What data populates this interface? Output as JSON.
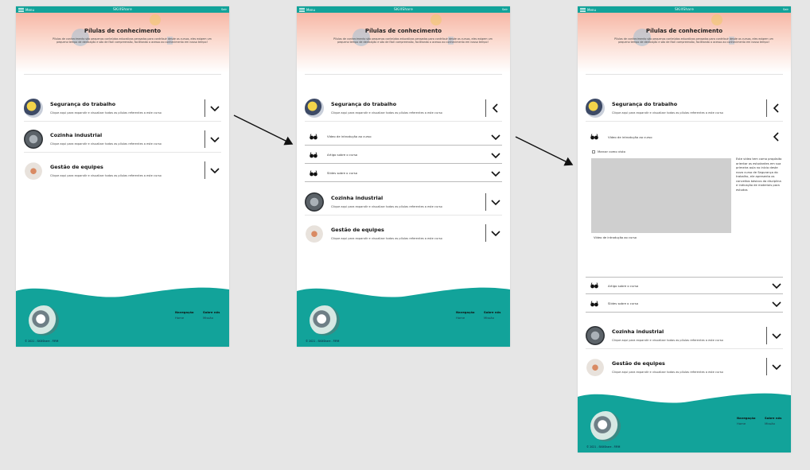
{
  "app": {
    "menu_label": "Menu",
    "brand": "SKillShare",
    "top_right": "Sair"
  },
  "hero": {
    "title": "Pílulas de conhecimento",
    "text": "Pílulas de conhecimento são pequenos conteúdos educativos pensados para contribuir desde os cursos, eles exigem um pequeno tempo de dedicação e são de fácil compreensão, facilitando o acesso ao conhecimento em nosso tempo!"
  },
  "courses": [
    {
      "title": "Segurança do trabalho",
      "desc": "Clique aqui para expandir e visualizar todas as pílulas referentes a este curso"
    },
    {
      "title": "Cozinha industrial",
      "desc": "Clique aqui para expandir e visualizar todas as pílulas referentes a este curso"
    },
    {
      "title": "Gestão de equipes",
      "desc": "Clique aqui para expandir e visualizar todas as pílulas referentes a este curso"
    }
  ],
  "lessons": [
    {
      "label": "Vídeo de introdução ao curso"
    },
    {
      "label": "Artigo sobre o curso"
    },
    {
      "label": "Slides sobre o curso"
    }
  ],
  "video_lesson": {
    "mark_viewed": "Marcar como visto",
    "description": "Este vídeo tem como propósito orientar os estudantes em sua primeira aula no início deste novo curso de Segurança do trabalho, ele apresenta os conceitos básicos da disciplina e indicação de materiais para estudos",
    "caption": "Vídeo de introdução ao curso"
  },
  "footer": {
    "nav_heading": "Navegação",
    "nav_item": "Home",
    "about_heading": "Sobre nós",
    "about_item": "Missão",
    "copyright": "© 2021 - SKillShare - FIRM"
  },
  "colors": {
    "teal": "#12a39a",
    "hero_top": "#f7b7a6"
  }
}
